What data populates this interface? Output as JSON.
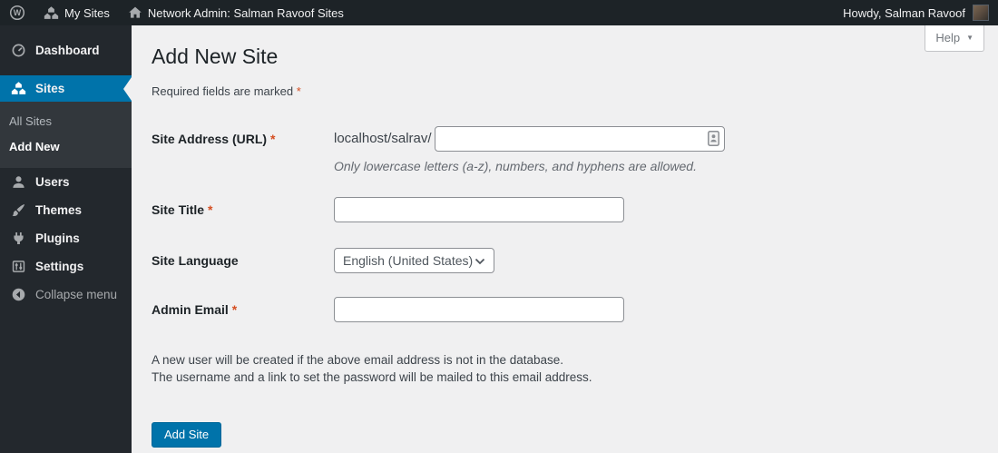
{
  "admin_bar": {
    "my_sites_label": "My Sites",
    "network_admin_label": "Network Admin: Salman Ravoof Sites",
    "howdy_label": "Howdy, Salman Ravoof"
  },
  "sidebar": {
    "items": [
      {
        "label": "Dashboard"
      },
      {
        "label": "Sites"
      },
      {
        "label": "Users"
      },
      {
        "label": "Themes"
      },
      {
        "label": "Plugins"
      },
      {
        "label": "Settings"
      }
    ],
    "submenu": [
      {
        "label": "All Sites"
      },
      {
        "label": "Add New"
      }
    ],
    "collapse_label": "Collapse menu"
  },
  "page": {
    "title": "Add New Site",
    "help_label": "Help",
    "help_chevron": "▼",
    "required_note": "Required fields are marked",
    "required_mark": "*"
  },
  "form": {
    "site_address": {
      "label": "Site Address (URL)",
      "required_mark": "*",
      "prefix": "localhost/salrav/",
      "value": "",
      "help": "Only lowercase letters (a-z), numbers, and hyphens are allowed."
    },
    "site_title": {
      "label": "Site Title",
      "required_mark": "*",
      "value": ""
    },
    "site_language": {
      "label": "Site Language",
      "selected_option": "English (United States)"
    },
    "admin_email": {
      "label": "Admin Email",
      "required_mark": "*",
      "value": ""
    },
    "email_note_line1": "A new user will be created if the above email address is not in the database.",
    "email_note_line2": "The username and a link to set the password will be mailed to this email address.",
    "submit_label": "Add Site"
  },
  "colors": {
    "accent_blue": "#0073aa",
    "admin_bar_bg": "#1d2327",
    "sidebar_bg": "#23282d",
    "submenu_bg": "#32373c",
    "content_bg": "#f0f0f1",
    "required_mark_color": "#d54e21"
  }
}
